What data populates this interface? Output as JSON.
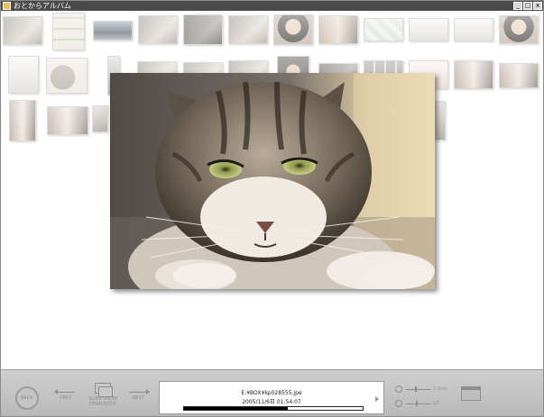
{
  "window": {
    "title": "おとからアルバム",
    "minimize_glyph": "_",
    "maximize_glyph": "□",
    "close_glyph": "x"
  },
  "icons": {
    "app": "app-icon",
    "back": "back-icon",
    "prev": "arrow-left-icon",
    "slideshow": "slideshow-icon",
    "next": "arrow-right-icon",
    "speed": "clock-icon",
    "zoom": "magnifier-icon",
    "folder": "folder-icon",
    "info_next": "triangle-right-icon"
  },
  "thumbnails": [
    {
      "kind": "cat"
    },
    {
      "kind": "tile-sheet"
    },
    {
      "kind": "car"
    },
    {
      "kind": "cat"
    },
    {
      "kind": "cat-dark"
    },
    {
      "kind": "cat"
    },
    {
      "kind": "portrait"
    },
    {
      "kind": "group"
    },
    {
      "kind": "map"
    },
    {
      "kind": "document"
    },
    {
      "kind": "document"
    },
    {
      "kind": "portrait"
    },
    {
      "kind": "document"
    },
    {
      "kind": "hedgehog"
    },
    {
      "kind": "product"
    },
    {
      "kind": "cat"
    },
    {
      "kind": "cat"
    },
    {
      "kind": "cat"
    },
    {
      "kind": "portrait-dark"
    },
    {
      "kind": "cat-dark"
    },
    {
      "kind": "grid"
    },
    {
      "kind": "page"
    },
    {
      "kind": "people"
    },
    {
      "kind": "people"
    },
    {
      "kind": "people"
    },
    {
      "kind": "people"
    },
    {
      "kind": "photo"
    },
    {
      "kind": "photo"
    }
  ],
  "main_photo": {
    "subject": "tabby cat lying on pavement"
  },
  "controls": {
    "back_label": "BACK",
    "prev_label": "PREV",
    "slideshow_label_1": "SLIDE SHOW",
    "slideshow_label_2": "START/STOP",
    "next_label": "NEXT",
    "speed_value": "2.0sec",
    "zoom_value": "x3",
    "speed_level": 0.35,
    "zoom_level": 0.4
  },
  "file_info": {
    "file_name": "E:¥BOX¥kp028555.jpe",
    "date": "2005/11/6日 01:54:07",
    "progress": 0.58
  }
}
